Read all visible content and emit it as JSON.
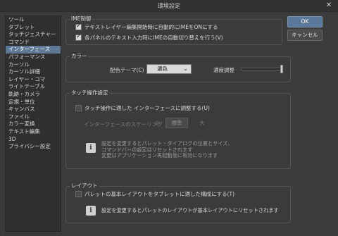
{
  "window": {
    "title": "環境設定",
    "close_glyph": "✕"
  },
  "sidebar": {
    "items": [
      {
        "label": "ツール"
      },
      {
        "label": "タブレット"
      },
      {
        "label": "タッチジェスチャー"
      },
      {
        "label": "コマンド"
      },
      {
        "label": "インターフェース",
        "selected": true
      },
      {
        "label": "パフォーマンス"
      },
      {
        "label": "カーソル"
      },
      {
        "label": "カーソル詳細"
      },
      {
        "label": "レイヤー・コマ"
      },
      {
        "label": "ライトテーブル"
      },
      {
        "label": "軌跡・カメラ"
      },
      {
        "label": "定規・単位"
      },
      {
        "label": "キャンバス"
      },
      {
        "label": "ファイル"
      },
      {
        "label": "カラー変換"
      },
      {
        "label": "テキスト編集"
      },
      {
        "label": "3D"
      },
      {
        "label": "プライバシー設定"
      }
    ]
  },
  "buttons": {
    "ok": "OK",
    "cancel": "キャンセル"
  },
  "ime": {
    "title": "IME制御",
    "opt1": {
      "label": "テキストレイヤー編集開始時に自動的にIMEをONにする",
      "checked": true
    },
    "opt2": {
      "label": "各パネルのテキスト入力時にIMEの自動切り替えを行う(V)",
      "checked": true
    }
  },
  "color": {
    "title": "カラー",
    "theme_label": "配色テーマ(C)",
    "theme_value": "濃色",
    "density_label": "濃度調整",
    "density_value": 1.0
  },
  "touch": {
    "title": "タッチ操作設定",
    "adjust_label": "タッチ操作に適した インターフェースに調整する(U)",
    "adjust_checked": false,
    "scaling_label": "インターフェースのスケーリング",
    "scaling_options": [
      "小",
      "標準",
      "大"
    ],
    "scaling_selected": "標準",
    "info_line1": "設定を変更するとパレット・ダイアログの位置とサイズ、",
    "info_line2": "コマンドバーの設定はリセットされます",
    "info_line3": "変更はアプリケーション再起動後に有効になります"
  },
  "layout": {
    "title": "レイアウト",
    "tablet_label": "パレットの基本レイアウトをタブレットに適した構成にする(T)",
    "tablet_checked": false,
    "info_text": "設定を変更するとパレットのレイアウトが基本レイアウトにリセットされます"
  },
  "icons": {
    "info": "info-icon",
    "close": "close-icon",
    "dropdown": "chevron-down-icon",
    "check": "check-icon"
  },
  "colors": {
    "background": "#3b3b3b",
    "selected": "#5f7896",
    "primary_button": "#5a7899"
  }
}
